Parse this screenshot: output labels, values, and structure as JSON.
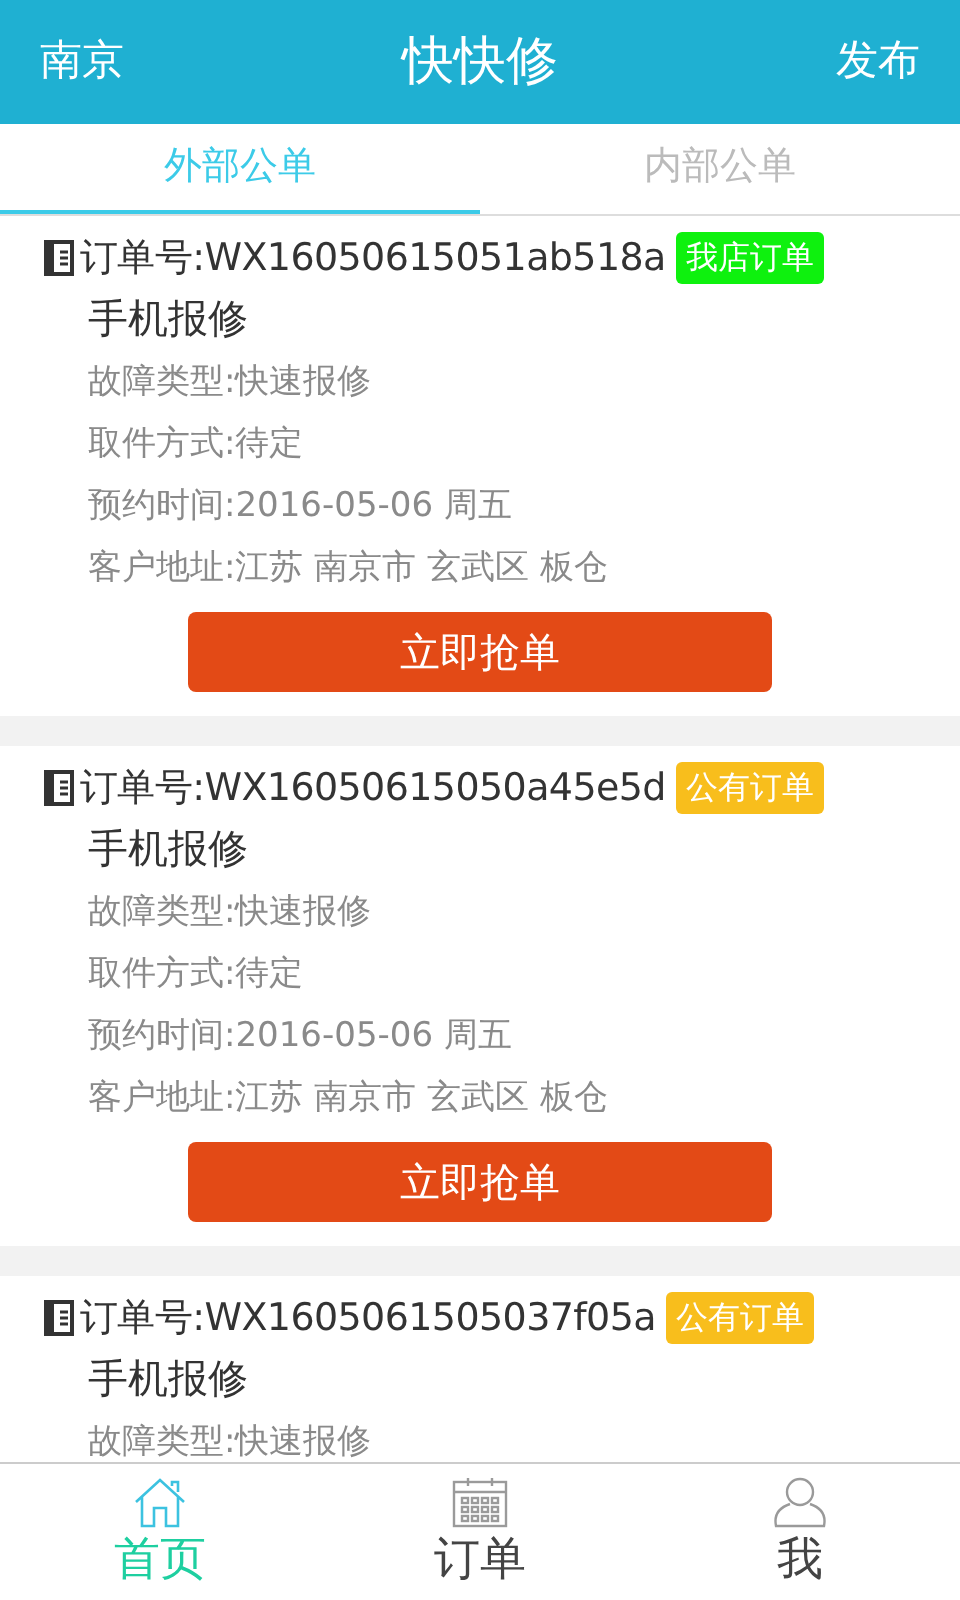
{
  "header": {
    "city": "南京",
    "title": "快快修",
    "action": "发布"
  },
  "tabs": [
    {
      "label": "外部公单",
      "selected": true
    },
    {
      "label": "内部公单",
      "selected": false
    }
  ],
  "orders": [
    {
      "order_no": "订单号:WX16050615051ab518a",
      "tag": "我店订单",
      "color": "#0ef10e",
      "title": "手机报修",
      "details": [
        "故障类型:快速报修",
        "取件方式:待定",
        "预约时间:2016-05-06 周五",
        "客户地址:江苏 南京市 玄武区 板仓"
      ],
      "button": "立即抢单"
    },
    {
      "order_no": "订单号:WX16050615050a45e5d",
      "tag": "公有订单",
      "color": "#f8be1c",
      "title": "手机报修",
      "details": [
        "故障类型:快速报修",
        "取件方式:待定",
        "预约时间:2016-05-06 周五",
        "客户地址:江苏 南京市 玄武区 板仓"
      ],
      "button": "立即抢单"
    },
    {
      "order_no": "订单号:WX1605061505037f05a",
      "tag": "公有订单",
      "color": "#f8be1c",
      "title": "手机报修",
      "details": [
        "故障类型:快速报修"
      ]
    }
  ],
  "nav": [
    {
      "kind": "home",
      "label": "首页",
      "selected": true
    },
    {
      "kind": "calendar",
      "label": "订单",
      "selected": false
    },
    {
      "kind": "person",
      "label": "我",
      "selected": false
    }
  ]
}
